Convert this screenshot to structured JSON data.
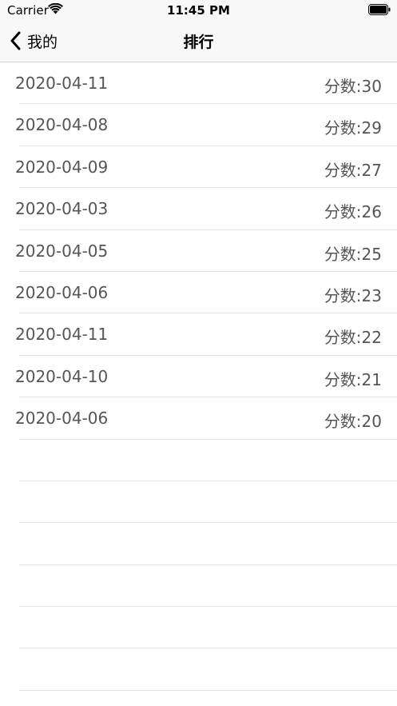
{
  "status_bar": {
    "carrier": "Carrier",
    "time": "11:45 PM"
  },
  "nav": {
    "back_label": "我的",
    "title": "排行"
  },
  "rows": [
    {
      "date": "2020-04-11",
      "score": "分数:30"
    },
    {
      "date": "2020-04-08",
      "score": "分数:29"
    },
    {
      "date": "2020-04-09",
      "score": "分数:27"
    },
    {
      "date": "2020-04-03",
      "score": "分数:26"
    },
    {
      "date": "2020-04-05",
      "score": "分数:25"
    },
    {
      "date": "2020-04-06",
      "score": "分数:23"
    },
    {
      "date": "2020-04-11",
      "score": "分数:22"
    },
    {
      "date": "2020-04-10",
      "score": "分数:21"
    },
    {
      "date": "2020-04-06",
      "score": "分数:20"
    }
  ],
  "colors": {
    "bar_background": "#f8f8f8",
    "row_text": "#555555",
    "separator": "#e2e2e5"
  }
}
